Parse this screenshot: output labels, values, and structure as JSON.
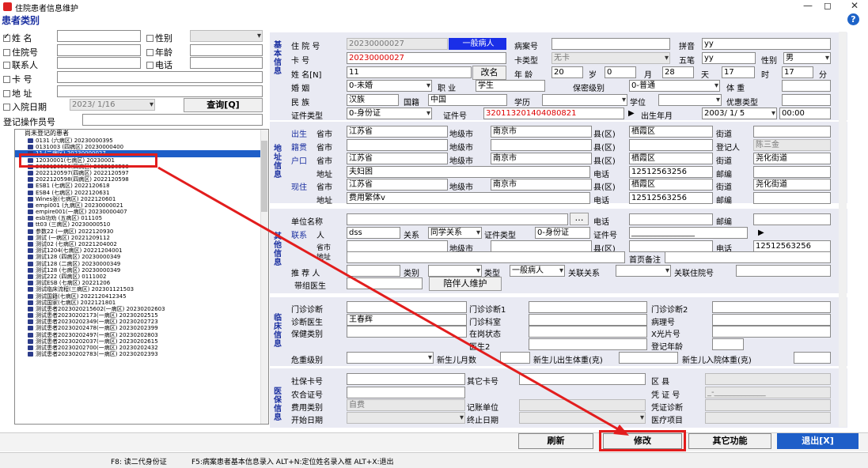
{
  "window": {
    "title": "住院患者信息维护",
    "min": "—",
    "max": "◻",
    "close": "✕"
  },
  "panel_title": "患者类别",
  "filters": {
    "name_label": "姓  名",
    "name_checked": true,
    "gender_label": "性别",
    "inpatient_label": "住院号",
    "age_label": "年龄",
    "contact_label": "联系人",
    "phone_label": "电话",
    "card_label": "卡  号",
    "address_label": "地  址",
    "admit_date_label": "入院日期",
    "admit_date_value": "2023/ 1/16",
    "query_button": "查询[Q]",
    "operator_label": "登记操作员号"
  },
  "tree": {
    "root": "尚未登记的患者",
    "items": [
      "0131   (六病区) 20230000395",
      "0131003 (四病区) 20230000400",
      "11     (二病区) 20230000027",
      "12030001(七病区) 20230001",
      "2022120596(四病区) 2022120596",
      "2022120597(四病区) 2022120597",
      "2022120598(四病区) 2022120598",
      "ESB1   (七病区) 2022120618",
      "ESB4   (七病区) 2022120631",
      "Wines张(七病区) 2022120601",
      "empi001 (九病区) 20230000021",
      "empire001(一病区) 20230000407",
      "esb功劝 (五病区) 011105",
      "tt03   (三病区) 20230000510",
      "参数22 (一病区) 2022120930",
      "测试   (一病区) 20221209112",
      "测试02 (七病区) 20221204002",
      "测试1204(七病区) 20221204001",
      "测试128 (四病区) 20230000349",
      "测试128 (二病区) 20230000349",
      "测试128 (七病区) 20230000349",
      "测试222 (四病区) 0111002",
      "测试ESB (七病区) 20221206",
      "测试临床流程(三病区) 202301121503",
      "测试国籍(七病区) 2022120412345",
      "测试国家(七病区) 2022121801",
      "测试患者2023020215602(一病区) 20230202603",
      "测试患者20230202173(一病区) 20230202515",
      "测试患者20230202349(一病区) 20230202723",
      "测试患者20230202478(一病区) 20230202399",
      "测试患者20230202497(一病区) 20230202803",
      "测试患者20230202037(一病区) 20230202615",
      "测试患者20230202700(一病区) 20230202432",
      "测试患者20230202783(一病区) 20230202393"
    ],
    "highlighted_index": 2
  },
  "basic": {
    "side": "基本信息",
    "inpatient_no_label": "住 院 号",
    "inpatient_no": "20230000027",
    "patient_type": "一般病人",
    "record_no_label": "病案号",
    "pinyin_label": "拼音",
    "pinyin": "yy",
    "card_label": "卡    号",
    "card_no": "20230000027",
    "card_type_label": "卡类型",
    "card_type": "无卡",
    "wubi_label": "五笔",
    "wubi": "yy",
    "gender_label": "性别",
    "gender": "男",
    "name_label": "姓 名[N]",
    "name": "11",
    "rename_button": "改名",
    "age_label": "年 龄",
    "age_years": "20",
    "sui": "岁",
    "age_months": "0",
    "yue": "月",
    "age_days": "28",
    "tian": "天",
    "age_hours": "17",
    "shi": "时",
    "age_min": "17",
    "fen": "分",
    "marital_label": "婚    姻",
    "marital": "0-未婚",
    "occupation_label": "职  业",
    "occupation": "学生",
    "security_label": "保密级别",
    "security": "0-普通",
    "weight_label": "体    重",
    "ethnicity_label": "民    族",
    "ethnicity": "汉族",
    "nationality_label": "国籍",
    "nationality": "中国",
    "education_label": "学历",
    "degree_label": "学位",
    "discount_label": "优惠类型",
    "idtype_label": "证件类型",
    "idtype": "0-身份证",
    "idno_label": "证件号",
    "idno": "320113201404080821",
    "birth_label": "出生年月",
    "birth_date": "2003/ 1/ 5",
    "birth_time": "00:00"
  },
  "address": {
    "side": "地址信息",
    "birth_label": "出生",
    "native_label": "籍贯",
    "hukou_label": "户口",
    "current_label": "现住",
    "province_label": "省市",
    "city_label": "地级市",
    "county_label": "县(区)",
    "street_label": "街道",
    "registrar_label": "登记人",
    "registrar": "陈三金",
    "zip_label": "邮编",
    "addr_label": "地址",
    "phone_label": "电话",
    "birth": {
      "province": "江苏省",
      "city": "南京市",
      "county": "栖霞区"
    },
    "hukou": {
      "province": "江苏省",
      "city": "南京市",
      "county": "栖霞区",
      "street": "尧化街道",
      "addr": "夫妇困",
      "phone": "12512563256"
    },
    "current": {
      "province": "江苏省",
      "city": "南京市",
      "county": "栖霞区",
      "street": "尧化街道",
      "addr": "费用繁体v",
      "phone": "12512563256"
    }
  },
  "other": {
    "side": "其他信息",
    "unit_label": "单位名称",
    "phone_label": "电话",
    "zip_label": "邮编",
    "contact_label": "联系",
    "person_label": "人",
    "contact": "dss",
    "relation_label": "关系",
    "relation": "同学关系",
    "idtype_label": "证件类型",
    "idtype": "0-身份证",
    "idno_label": "证件号",
    "idno": "________________",
    "province_label": "省市",
    "city_label": "地级市",
    "county_label": "县(区)",
    "phone": "12512563256",
    "addr_label": "地址",
    "home_label": "首页备注",
    "referrer_label": "推 荐 人",
    "category_label": "类别",
    "type_label": "类型",
    "type": "一般病人",
    "assoc_label": "关联关系",
    "assoc_no_label": "关联住院号",
    "doctor_label": "带组医生",
    "companion_button": "陪伴人维护"
  },
  "clinical": {
    "side": "临床信息",
    "outpatient_diag_label": "门诊诊断",
    "outpatient_diag1_label": "门诊诊断1",
    "outpatient_diag2_label": "门诊诊断2",
    "doctor_label": "诊断医生",
    "doctor": "王春辉",
    "dept_label": "门诊科室",
    "case_no_label": "病理号",
    "insurance_type_label": "保健类别",
    "status_label": "在岗状态",
    "xray_label": "X光片号",
    "diag2_label": "医生2",
    "reg_age_label": "登记年龄",
    "danger_label": "危重级别",
    "newborn_count_label": "新生儿月数",
    "newborn_weight_label": "新生儿出生体重(克)",
    "newborn_admit_weight_label": "新生儿入院体重(克)"
  },
  "insurance": {
    "side": "医保信息",
    "ss_label": "社保卡号",
    "other_card_label": "其它卡号",
    "district_label": "区    县",
    "cooperative_label": "农合证号",
    "cert_label": "凭 证 号",
    "cert": "_-_____________",
    "fee_type_label": "费用类别",
    "fee_type": "自费",
    "unit_label": "记账单位",
    "cert_diag_label": "凭证诊断",
    "start_label": "开始日期",
    "end_label": "终止日期",
    "medical_label": "医疗项目"
  },
  "buttons": {
    "refresh": "刷新",
    "modify": "修改",
    "other": "其它功能",
    "exit": "退出[X]"
  },
  "status": {
    "f8": "F8: 读二代身份证",
    "f5": "F5:病案患者基本信息录入 ALT+N:定位姓名录入框 ALT+X:退出"
  }
}
